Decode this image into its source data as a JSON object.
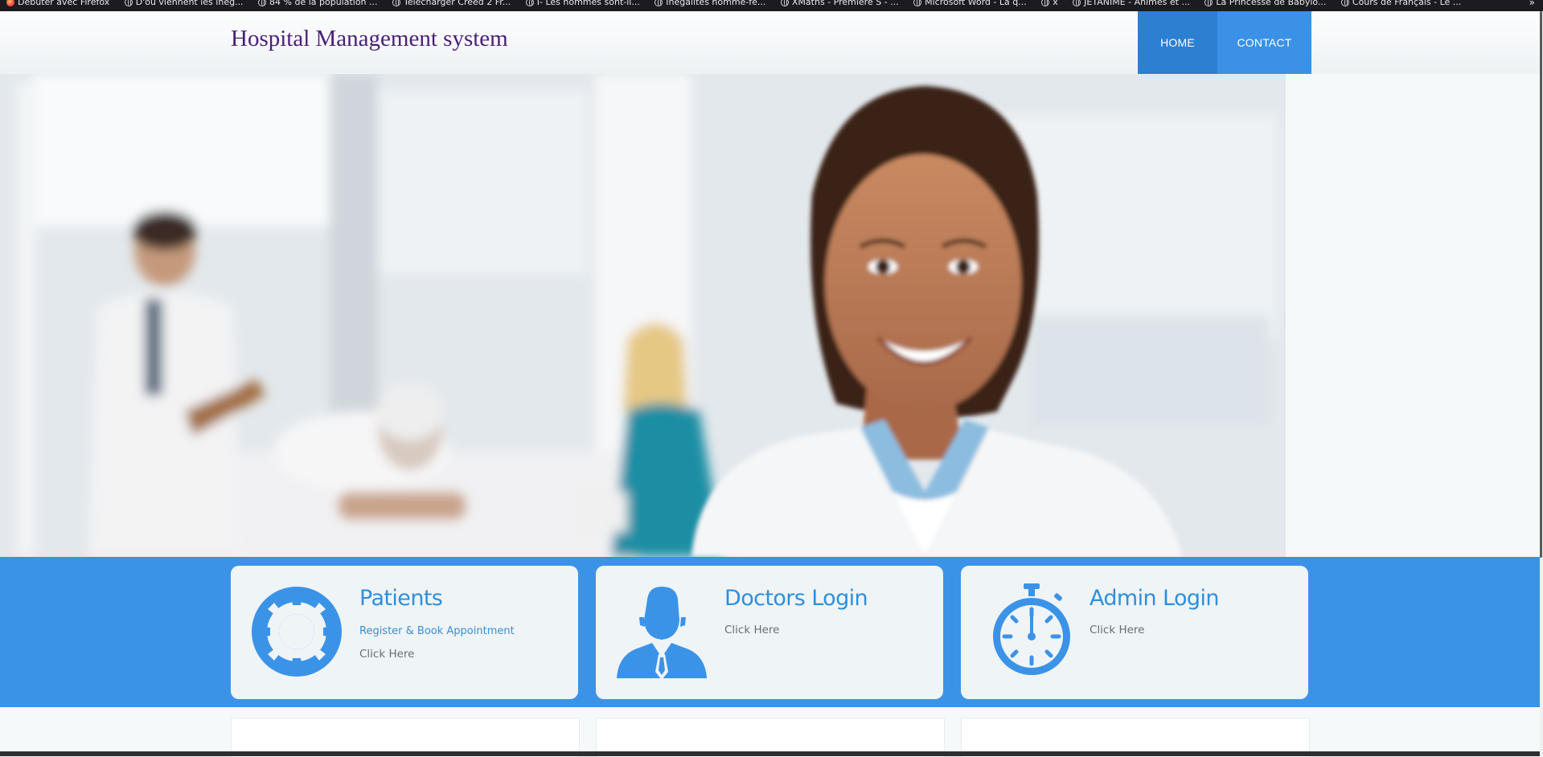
{
  "bookmarks": [
    {
      "label": "Débuter avec Firefox",
      "icon": "firefox-icon"
    },
    {
      "label": "D'où viennent les inég...",
      "icon": "globe-icon"
    },
    {
      "label": "84 % de la population ...",
      "icon": "globe-icon"
    },
    {
      "label": "Télécharger Creed 2 Fr...",
      "icon": "globe-icon"
    },
    {
      "label": "I- Les hommes sont-il...",
      "icon": "globe-icon"
    },
    {
      "label": "Inégalités homme-fe...",
      "icon": "globe-icon"
    },
    {
      "label": "XMaths - Première S - ...",
      "icon": "globe-icon"
    },
    {
      "label": "Microsoft Word - La q...",
      "icon": "globe-icon"
    },
    {
      "label": "x",
      "icon": "globe-icon"
    },
    {
      "label": "JETANIME - Animés et ...",
      "icon": "globe-icon"
    },
    {
      "label": "La Princesse de Babylo...",
      "icon": "globe-icon"
    },
    {
      "label": "Cours de Français - Le ...",
      "icon": "globe-icon"
    }
  ],
  "bookmarks_overflow": "»",
  "header": {
    "title": "Hospital Management system",
    "nav": {
      "home": "HOME",
      "contact": "CONTACT"
    }
  },
  "cards": [
    {
      "title": "Patients",
      "subtitle": "Register & Book Appointment",
      "link": "Click Here",
      "icon": "lifebuoy-icon"
    },
    {
      "title": "Doctors Login",
      "subtitle": "",
      "link": "Click Here",
      "icon": "doctor-icon"
    },
    {
      "title": "Admin Login",
      "subtitle": "",
      "link": "Click Here",
      "icon": "stopwatch-icon"
    }
  ],
  "colors": {
    "accent": "#3b93e8",
    "nav_home": "#2c7fd1",
    "title": "#4a1f78",
    "card_bg": "#eff4f7"
  }
}
